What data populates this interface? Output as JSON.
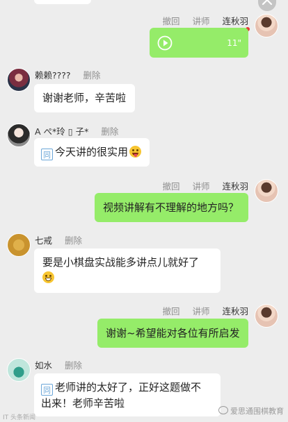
{
  "top_partial": {
    "delete_label": "删除"
  },
  "actions": {
    "withdraw": "撤回",
    "lecture": "讲师",
    "delete": "删除"
  },
  "messages": [
    {
      "sender": "连秋羽",
      "side": "right",
      "type": "voice",
      "duration": "11\""
    },
    {
      "sender": "赖赖????",
      "side": "left",
      "type": "text",
      "text": "谢谢老师，辛苦啦"
    },
    {
      "sender": "A ぺ*玲 ▯ 子*",
      "side": "left",
      "type": "text",
      "text": "今天讲的很实用",
      "emoji": "tongue-out-emoji"
    },
    {
      "sender": "连秋羽",
      "side": "right",
      "type": "text",
      "text": "视频讲解有不理解的地方吗？"
    },
    {
      "sender": "七戒",
      "side": "left",
      "type": "text",
      "text_line1": "要是小棋盘实战能多讲点儿就好了",
      "emoji": "grin-emoji"
    },
    {
      "sender": "连秋羽",
      "side": "right",
      "type": "text",
      "text": "谢谢~希望能对各位有所启发"
    },
    {
      "sender": "如水",
      "side": "left",
      "type": "text",
      "text_line1": "老师讲的太好了，正好这题做不",
      "text_line2": "出来！老师辛苦啦"
    }
  ],
  "watermark": {
    "left": "IT 头条新闻",
    "right": "爱思通围棋教育"
  },
  "colors": {
    "background": "#ededed",
    "my_bubble": "#95ec69",
    "other_bubble": "#ffffff"
  }
}
